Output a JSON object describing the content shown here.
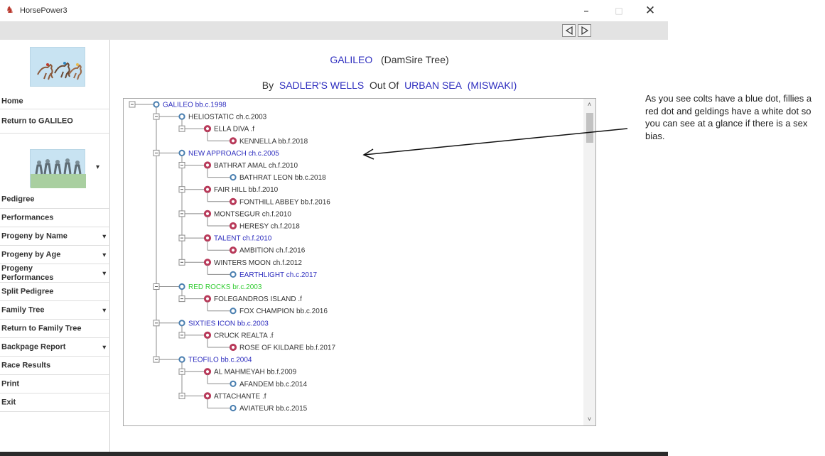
{
  "window": {
    "title": "HorsePower3",
    "minimize": "–",
    "maximize": "□",
    "close": "✕"
  },
  "toolbar": {
    "prev_icon": "triangle-left-icon",
    "next_icon": "triangle-right-icon"
  },
  "sidebar": {
    "items": [
      {
        "label": "Home",
        "has_arrow": false
      },
      {
        "label": "Return to GALILEO",
        "has_arrow": false
      },
      {
        "label": "Pedigree",
        "has_arrow": false
      },
      {
        "label": "Performances",
        "has_arrow": false
      },
      {
        "label": "Progeny by Name",
        "has_arrow": true
      },
      {
        "label": "Progeny by Age",
        "has_arrow": true
      },
      {
        "label": "Progeny Performances",
        "has_arrow": true
      },
      {
        "label": "Split Pedigree",
        "has_arrow": false
      },
      {
        "label": "Family Tree",
        "has_arrow": true
      },
      {
        "label": "Return to Family Tree",
        "has_arrow": false
      },
      {
        "label": "Backpage Report",
        "has_arrow": true
      },
      {
        "label": "Race Results",
        "has_arrow": false
      },
      {
        "label": "Print",
        "has_arrow": false
      },
      {
        "label": "Exit",
        "has_arrow": false
      }
    ],
    "arrow": "▾",
    "logo_arrow": "▾"
  },
  "header": {
    "horse": "GALILEO",
    "tree_type": "(DamSire Tree)",
    "by_label": "By",
    "sire": "SADLER'S WELLS",
    "out_of_label": "Out Of",
    "dam": "URBAN SEA",
    "dam_sire": "(MISWAKI)"
  },
  "colors": {
    "blue_text": "#2e2ebf",
    "green_text": "#33cc33",
    "dark_text": "#333333",
    "colt_dot": "#4a7fb0",
    "filly_dot": "#b83a5a"
  },
  "tree": [
    {
      "depth": 0,
      "label": "GALILEO bb.c.1998",
      "sex": "colt",
      "color": "blue"
    },
    {
      "depth": 1,
      "label": "HELIOSTATIC ch.c.2003",
      "sex": "colt",
      "color": "dark"
    },
    {
      "depth": 2,
      "label": "ELLA DIVA .f",
      "sex": "filly",
      "color": "dark"
    },
    {
      "depth": 3,
      "label": "KENNELLA bb.f.2018",
      "sex": "filly",
      "color": "dark"
    },
    {
      "depth": 1,
      "label": "NEW APPROACH ch.c.2005",
      "sex": "colt",
      "color": "blue"
    },
    {
      "depth": 2,
      "label": "BATHRAT AMAL ch.f.2010",
      "sex": "filly",
      "color": "dark"
    },
    {
      "depth": 3,
      "label": "BATHRAT LEON bb.c.2018",
      "sex": "colt",
      "color": "dark"
    },
    {
      "depth": 2,
      "label": "FAIR HILL bb.f.2010",
      "sex": "filly",
      "color": "dark"
    },
    {
      "depth": 3,
      "label": "FONTHILL ABBEY bb.f.2016",
      "sex": "filly",
      "color": "dark"
    },
    {
      "depth": 2,
      "label": "MONTSEGUR ch.f.2010",
      "sex": "filly",
      "color": "dark"
    },
    {
      "depth": 3,
      "label": "HERESY ch.f.2018",
      "sex": "filly",
      "color": "dark"
    },
    {
      "depth": 2,
      "label": "TALENT ch.f.2010",
      "sex": "filly",
      "color": "blue"
    },
    {
      "depth": 3,
      "label": "AMBITION ch.f.2016",
      "sex": "filly",
      "color": "dark"
    },
    {
      "depth": 2,
      "label": "WINTERS MOON ch.f.2012",
      "sex": "filly",
      "color": "dark"
    },
    {
      "depth": 3,
      "label": "EARTHLIGHT ch.c.2017",
      "sex": "colt",
      "color": "blue"
    },
    {
      "depth": 1,
      "label": "RED ROCKS br.c.2003",
      "sex": "colt",
      "color": "green"
    },
    {
      "depth": 2,
      "label": "FOLEGANDROS ISLAND .f",
      "sex": "filly",
      "color": "dark"
    },
    {
      "depth": 3,
      "label": "FOX CHAMPION bb.c.2016",
      "sex": "colt",
      "color": "dark"
    },
    {
      "depth": 1,
      "label": "SIXTIES ICON bb.c.2003",
      "sex": "colt",
      "color": "blue"
    },
    {
      "depth": 2,
      "label": "CRUCK REALTA .f",
      "sex": "filly",
      "color": "dark"
    },
    {
      "depth": 3,
      "label": "ROSE OF KILDARE bb.f.2017",
      "sex": "filly",
      "color": "dark"
    },
    {
      "depth": 1,
      "label": "TEOFILO bb.c.2004",
      "sex": "colt",
      "color": "blue"
    },
    {
      "depth": 2,
      "label": "AL MAHMEYAH bb.f.2009",
      "sex": "filly",
      "color": "dark"
    },
    {
      "depth": 3,
      "label": "AFANDEM bb.c.2014",
      "sex": "colt",
      "color": "dark"
    },
    {
      "depth": 2,
      "label": "ATTACHANTE .f",
      "sex": "filly",
      "color": "dark"
    },
    {
      "depth": 3,
      "label": "AVIATEUR bb.c.2015",
      "sex": "colt",
      "color": "dark"
    }
  ],
  "scrollbar": {
    "up": "˄",
    "down": "˅"
  },
  "annotation": {
    "text": "As you see colts have a blue dot, fillies a red dot and geldings have a white dot so you can see at a glance if there is a sex bias."
  }
}
